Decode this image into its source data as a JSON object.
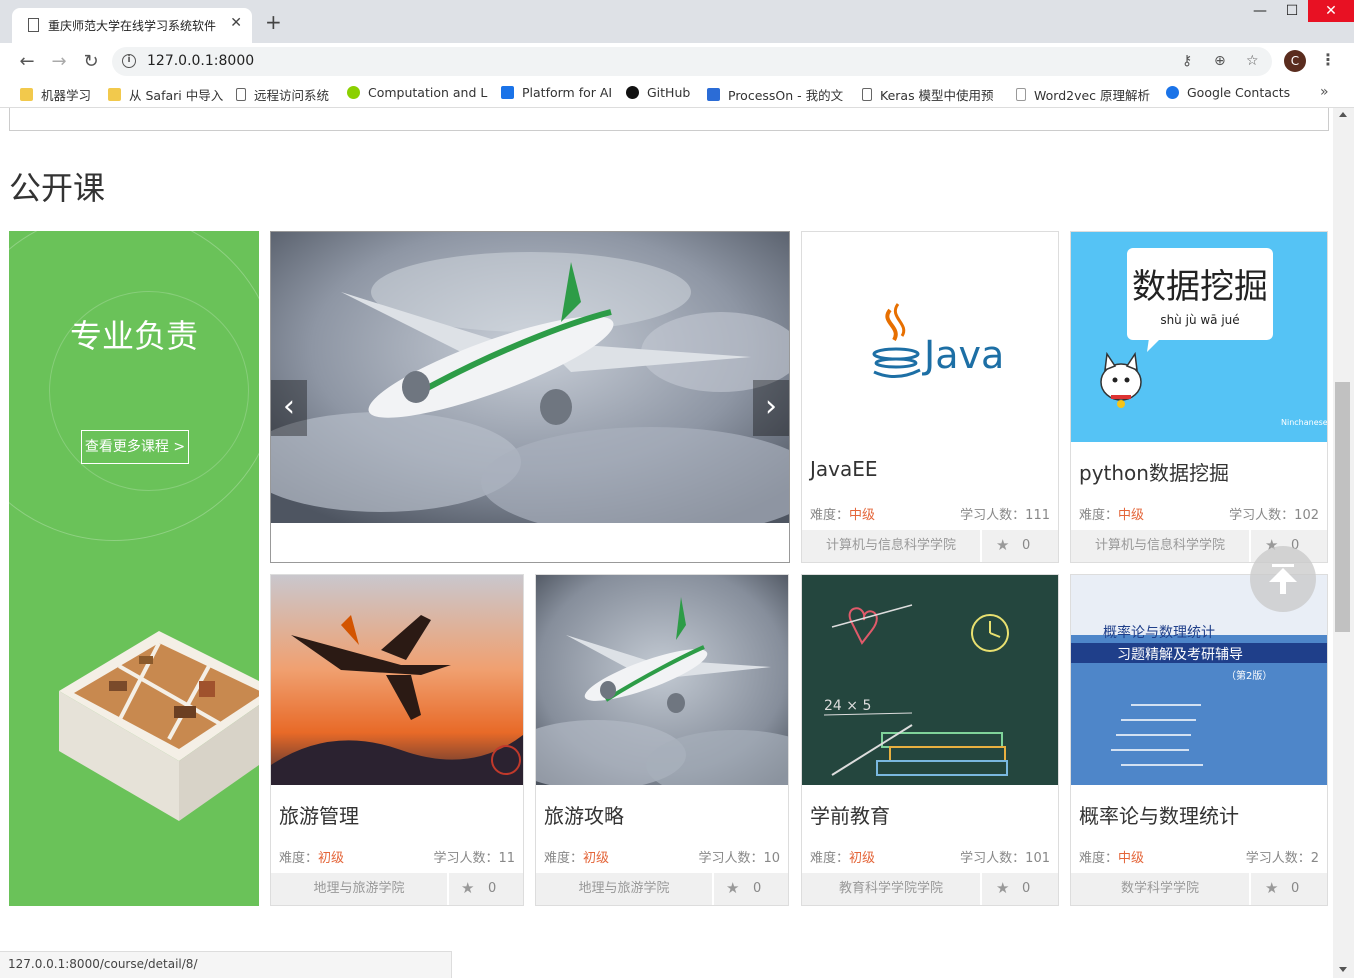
{
  "browser": {
    "tab_title": "重庆师范大学在线学习系统软件",
    "url": "127.0.0.1:8000",
    "window_controls": {
      "minimize": "—",
      "maximize": "☐",
      "close": "✕"
    },
    "profile_initial": "C",
    "bookmarks": [
      {
        "label": "机器学习",
        "icon": "folder-icon"
      },
      {
        "label": "从 Safari 中导入",
        "icon": "folder-icon"
      },
      {
        "label": "远程访问系统",
        "icon": "page-icon"
      },
      {
        "label": "Computation and L",
        "icon": "smiley-icon"
      },
      {
        "label": "Platform for AI",
        "icon": "cube-icon"
      },
      {
        "label": "GitHub",
        "icon": "github-icon"
      },
      {
        "label": "ProcessOn - 我的文",
        "icon": "processon-icon"
      },
      {
        "label": "Keras 模型中使用预",
        "icon": "page-icon"
      },
      {
        "label": "Word2vec 原理解析",
        "icon": "page-icon"
      },
      {
        "label": "Google Contacts",
        "icon": "contacts-icon"
      }
    ],
    "status_url": "127.0.0.1:8000/course/detail/8/"
  },
  "colors": {
    "promo_green": "#6ac259",
    "level_orange": "#e4663a",
    "close_red": "#e81123"
  },
  "section": {
    "title": "公开课",
    "promo_heading": "专业负责",
    "promo_button": "查看更多课程 >"
  },
  "labels": {
    "difficulty": "难度：",
    "learners": "学习人数："
  },
  "courses": [
    {
      "name": "JavaEE",
      "level": "中级",
      "learners": "111",
      "org": "计算机与信息科学学院",
      "favs": "0",
      "image": "java-logo",
      "image_text": "Java"
    },
    {
      "name": "python数据挖掘",
      "level": "中级",
      "learners": "102",
      "org": "计算机与信息科学学院",
      "favs": "0",
      "image": "data-mining-cartoon",
      "image_text": "数据挖掘",
      "image_sub": "shù jù wā jué",
      "image_brand": "Ninchanese"
    },
    {
      "name": "旅游管理",
      "level": "初级",
      "learners": "11",
      "org": "地理与旅游学院",
      "favs": "0",
      "image": "sunset-plane"
    },
    {
      "name": "旅游攻略",
      "level": "初级",
      "learners": "10",
      "org": "地理与旅游学院",
      "favs": "0",
      "image": "eva-plane"
    },
    {
      "name": "学前教育",
      "level": "初级",
      "learners": "101",
      "org": "教育科学学院学院",
      "favs": "0",
      "image": "chalkboard"
    },
    {
      "name": "概率论与数理统计",
      "level": "中级",
      "learners": "2",
      "org": "数学科学学院",
      "favs": "0",
      "image": "book-cover",
      "image_text": "概率论与数理统计",
      "image_sub": "习题精解及考研辅导",
      "image_ed": "（第2版）"
    }
  ]
}
